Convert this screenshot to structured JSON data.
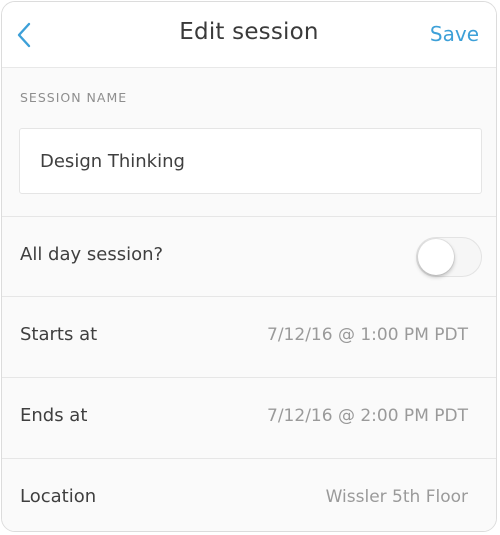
{
  "header": {
    "title": "Edit session",
    "save_label": "Save",
    "back_icon": "chevron-left-icon"
  },
  "session_name": {
    "label": "SESSION NAME",
    "value": "Design Thinking"
  },
  "all_day": {
    "label": "All day session?",
    "enabled": false
  },
  "starts_at": {
    "label": "Starts at",
    "value": "7/12/16 @ 1:00 PM PDT"
  },
  "ends_at": {
    "label": "Ends at",
    "value": "7/12/16 @ 2:00 PM PDT"
  },
  "location": {
    "label": "Location",
    "value": "Wissler 5th Floor"
  },
  "colors": {
    "accent": "#3da0d8",
    "text_primary": "#3f3f3f",
    "text_secondary": "#9a9a9a"
  }
}
